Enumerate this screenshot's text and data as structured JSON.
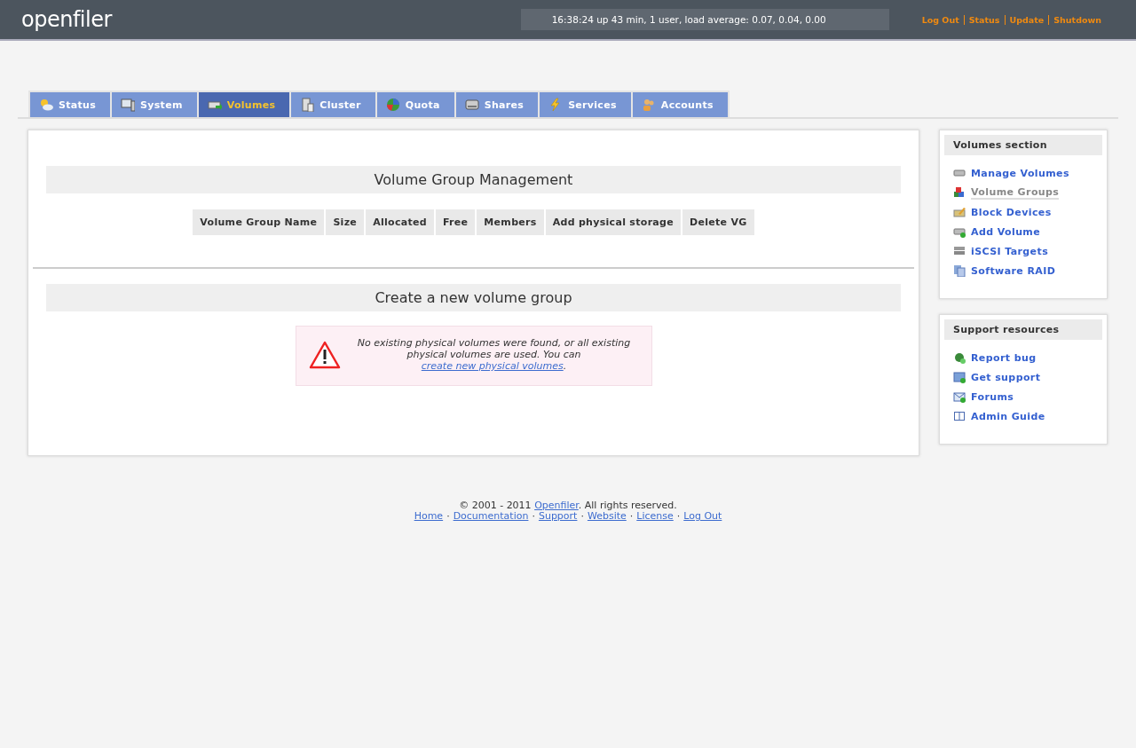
{
  "header": {
    "logo": "openfiler",
    "status": "16:38:24 up 43 min, 1 user, load average: 0.07, 0.04, 0.00",
    "links": [
      "Log Out",
      "Status",
      "Update",
      "Shutdown"
    ]
  },
  "tabs": [
    {
      "label": "Status",
      "selected": false
    },
    {
      "label": "System",
      "selected": false
    },
    {
      "label": "Volumes",
      "selected": true
    },
    {
      "label": "Cluster",
      "selected": false
    },
    {
      "label": "Quota",
      "selected": false
    },
    {
      "label": "Shares",
      "selected": false
    },
    {
      "label": "Services",
      "selected": false
    },
    {
      "label": "Accounts",
      "selected": false
    }
  ],
  "main": {
    "vg_title": "Volume Group Management",
    "table": {
      "columns": [
        "Volume Group Name",
        "Size",
        "Allocated",
        "Free",
        "Members",
        "Add physical storage",
        "Delete VG"
      ]
    },
    "create_title": "Create a new volume group",
    "warning": {
      "text": "No existing physical volumes were found, or all existing physical volumes are used. You can",
      "link": "create new physical volumes",
      "after": "."
    }
  },
  "sidebar": [
    {
      "title": "Volumes section",
      "items": [
        {
          "label": "Manage Volumes",
          "selected": false
        },
        {
          "label": "Volume Groups",
          "selected": true
        },
        {
          "label": "Block Devices",
          "selected": false
        },
        {
          "label": "Add Volume",
          "selected": false
        },
        {
          "label": "iSCSI Targets",
          "selected": false
        },
        {
          "label": "Software RAID",
          "selected": false
        }
      ]
    },
    {
      "title": "Support resources",
      "items": [
        {
          "label": "Report bug",
          "selected": false
        },
        {
          "label": "Get support",
          "selected": false
        },
        {
          "label": "Forums",
          "selected": false
        },
        {
          "label": "Admin Guide",
          "selected": false
        }
      ]
    }
  ],
  "footer": {
    "copyright": "© 2001 - 2011",
    "copyright_link": "Openfiler",
    "copyright_after": ". All rights reserved.",
    "separator": "·",
    "links": [
      "Home",
      "Documentation",
      "Support",
      "Website",
      "License",
      "Log Out"
    ]
  }
}
